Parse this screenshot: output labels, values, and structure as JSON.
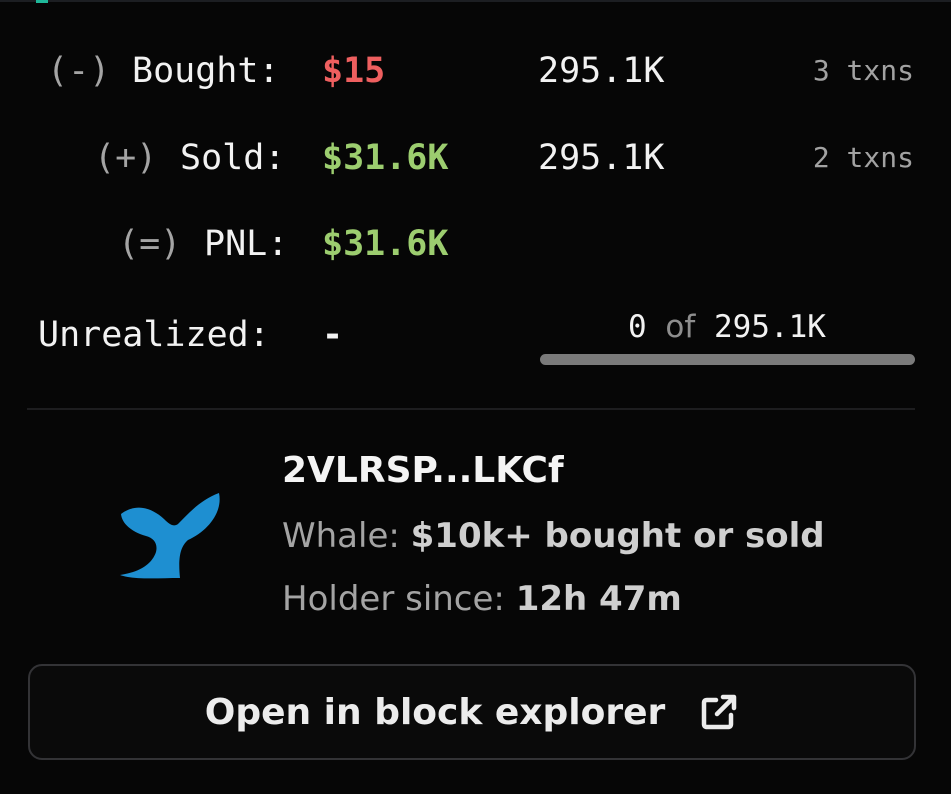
{
  "accent_color": "#1fb89a",
  "trades": {
    "bought": {
      "sign": "(-)",
      "label": "Bought:",
      "value": "$15",
      "value_color": "#ee5f5f",
      "amount": "295.1K",
      "txns": "3 txns"
    },
    "sold": {
      "sign": "(+)",
      "label": "Sold:",
      "value": "$31.6K",
      "value_color": "#9ccd6f",
      "amount": "295.1K",
      "txns": "2 txns"
    },
    "pnl": {
      "sign": "(=)",
      "label": "PNL:",
      "value": "$31.6K",
      "value_color": "#9ccd6f"
    }
  },
  "unrealized": {
    "label": "Unrealized:",
    "value": "-",
    "held": "0",
    "of_text": "of",
    "total": "295.1K",
    "progress_fraction": 0
  },
  "wallet": {
    "name": "2VLRSP...LKCf",
    "icon": "whale-tail-icon",
    "icon_color": "#1e8fd1",
    "tag_label": "Whale:",
    "tag_value": "$10k+ bought or sold",
    "holder_label": "Holder since:",
    "holder_value": "12h 47m"
  },
  "explorer_button": {
    "label": "Open in block explorer",
    "icon": "external-link-icon"
  }
}
